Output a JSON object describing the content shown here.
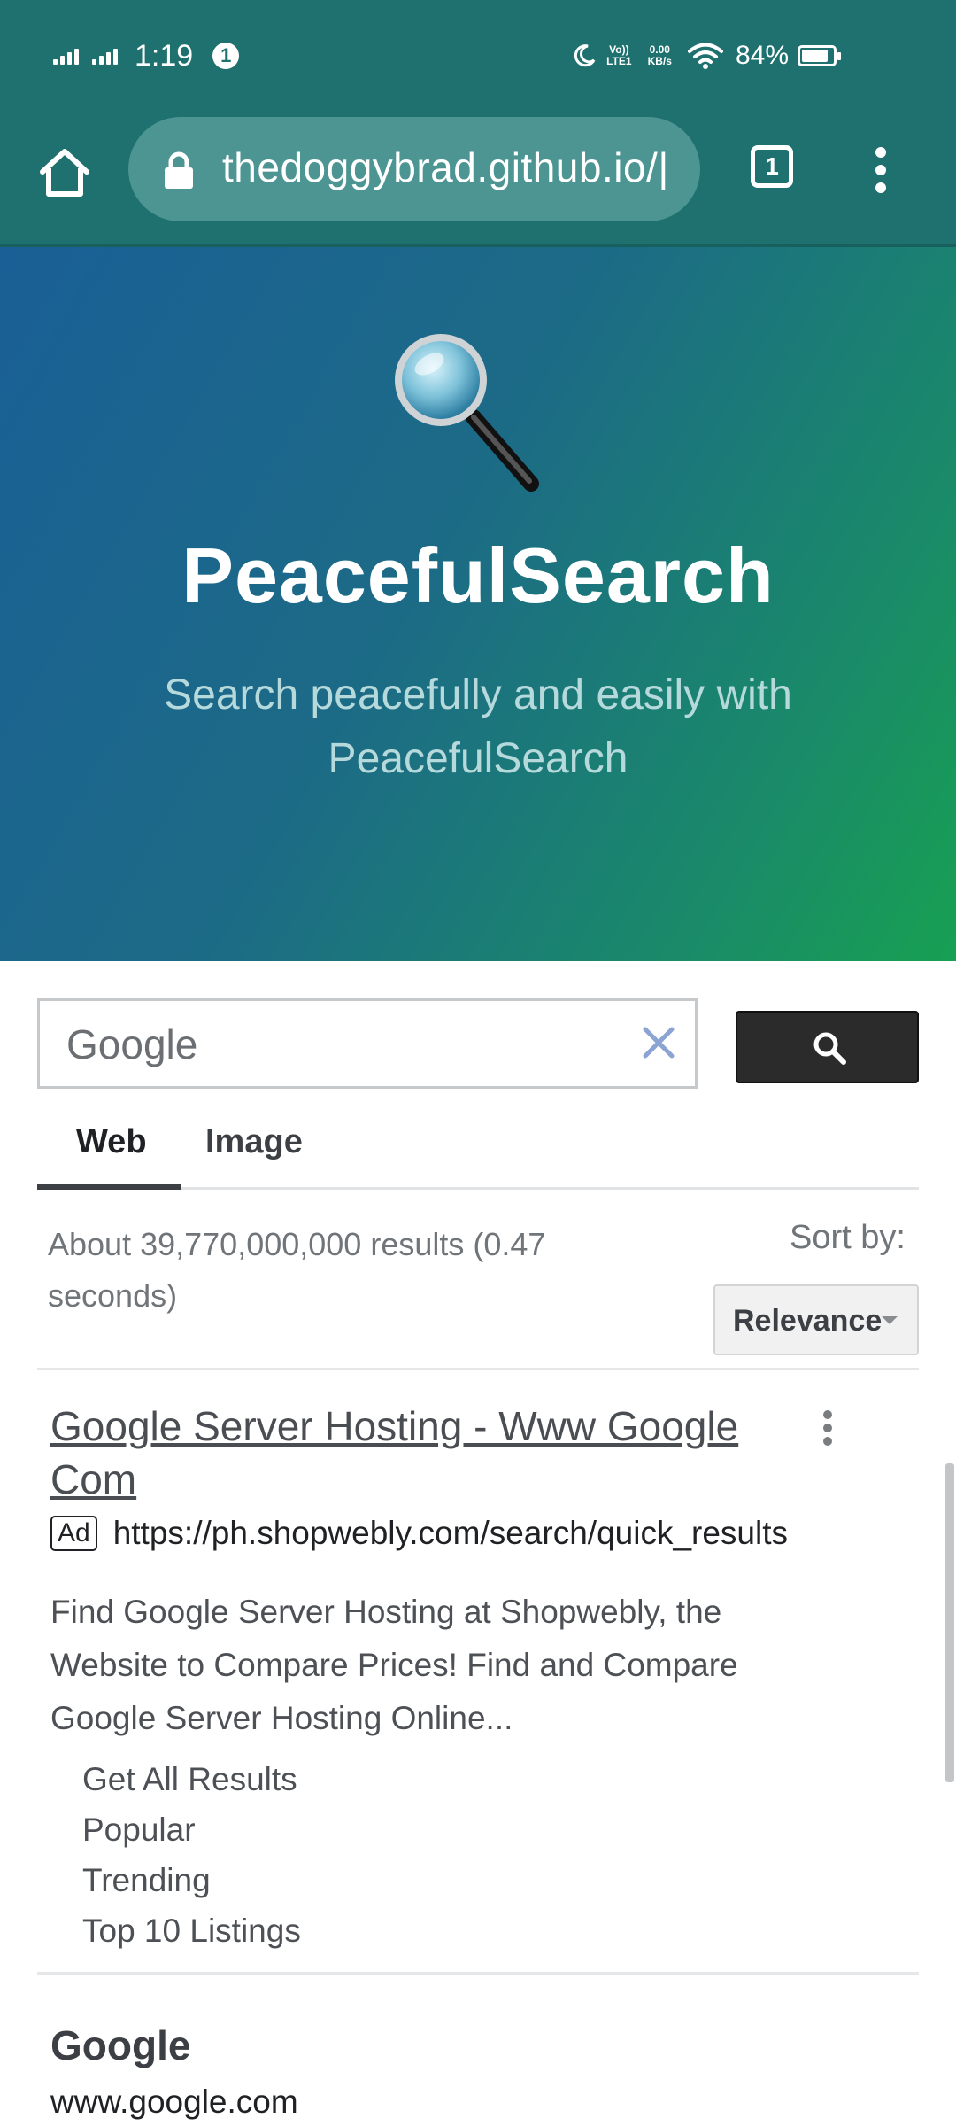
{
  "status_bar": {
    "time": "1:19",
    "notification_count": "1",
    "volte_top": "Vo))",
    "volte_bottom": "LTE1",
    "speed_value": "0.00",
    "speed_unit": "KB/s",
    "battery": "84%",
    "battery_level": 0.84,
    "icons": [
      "signal-icon",
      "signal-icon",
      "notification-icon",
      "moon-icon",
      "volte-icon",
      "wifi-icon",
      "battery-icon"
    ]
  },
  "browser": {
    "url": "thedoggybrad.github.io/|",
    "tab_count": "1",
    "icons": [
      "home-icon",
      "lock-icon",
      "tab-switcher-icon",
      "more-vert-icon"
    ]
  },
  "hero": {
    "title": "PeacefulSearch",
    "subtitle": "Search peacefully and easily with PeacefulSearch",
    "icon": "magnifying-glass-logo-icon",
    "colors": {
      "gradient_start": "#1a5f96",
      "gradient_end": "#17a052"
    }
  },
  "search": {
    "query": "Google",
    "icons": [
      "clear-icon",
      "search-icon"
    ]
  },
  "tabs": [
    {
      "label": "Web",
      "active": true
    },
    {
      "label": "Image",
      "active": false
    }
  ],
  "results": {
    "summary": "About 39,770,000,000 results (0.47 seconds)",
    "sort_label": "Sort by:",
    "sort_value": "Relevance"
  },
  "ad_result": {
    "title": "Google Server Hosting - Www Google Com",
    "badge": "Ad",
    "url": "https://ph.shopwebly.com/search/quick_results",
    "description": "Find Google Server Hosting at Shopwebly, the Website to Compare Prices! Find and Compare Google Server Hosting Online...",
    "sitelinks": [
      "Get All Results",
      "Popular",
      "Trending",
      "Top 10 Listings"
    ]
  },
  "organic_result": {
    "title": "Google",
    "url": "www.google.com"
  }
}
